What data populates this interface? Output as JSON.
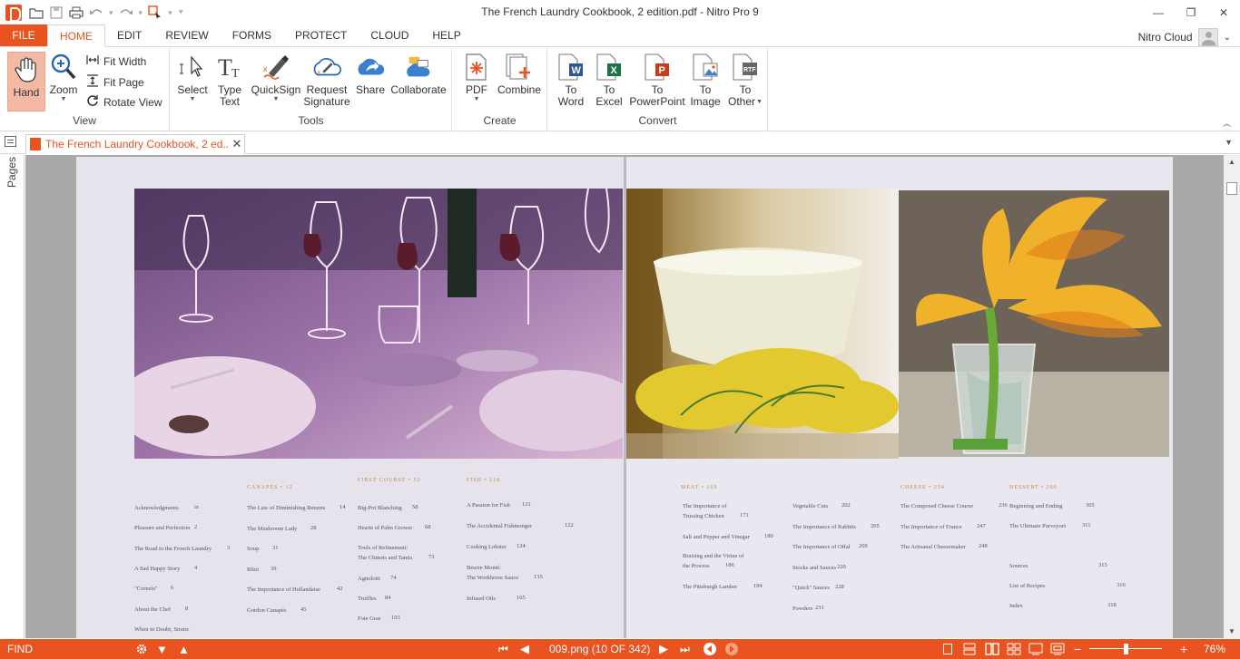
{
  "window": {
    "title": "The French Laundry Cookbook, 2 edition.pdf - Nitro Pro 9",
    "minimize_glyph": "—",
    "restore_glyph": "❐",
    "close_glyph": "✕"
  },
  "ribbon_tabs": {
    "file": "FILE",
    "tabs": [
      "HOME",
      "EDIT",
      "REVIEW",
      "FORMS",
      "PROTECT",
      "CLOUD",
      "HELP"
    ],
    "active": "HOME"
  },
  "cloud": {
    "label": "Nitro Cloud"
  },
  "ribbon": {
    "view": {
      "label": "View",
      "hand": "Hand",
      "zoom": "Zoom",
      "fit_width": "Fit Width",
      "fit_page": "Fit Page",
      "rotate_view": "Rotate View"
    },
    "tools": {
      "label": "Tools",
      "select": "Select",
      "type_text_1": "Type",
      "type_text_2": "Text",
      "quicksign": "QuickSign",
      "request_sig_1": "Request",
      "request_sig_2": "Signature",
      "share": "Share",
      "collaborate": "Collaborate"
    },
    "create": {
      "label": "Create",
      "pdf": "PDF",
      "combine": "Combine"
    },
    "convert": {
      "label": "Convert",
      "to_word_1": "To",
      "to_word_2": "Word",
      "to_excel_1": "To",
      "to_excel_2": "Excel",
      "to_ppt_1": "To",
      "to_ppt_2": "PowerPoint",
      "to_image_1": "To",
      "to_image_2": "Image",
      "to_other_1": "To",
      "to_other_2": "Other"
    }
  },
  "doc_tab": {
    "title": "The French Laundry Cookbook, 2 ed...",
    "close": "✕"
  },
  "side_panel": {
    "pages_label": "Pages"
  },
  "toc": {
    "front": [
      {
        "t": "Acknowledgments",
        "p": "ix"
      },
      {
        "t": "Pleasure and Perfection",
        "p": "2"
      },
      {
        "t": "The Road to the French Laundry",
        "p": "3"
      },
      {
        "t": "A Sad Happy Story",
        "p": "4"
      },
      {
        "t": "\"Cornets\"",
        "p": "6"
      },
      {
        "t": "About the Chef",
        "p": "8"
      },
      {
        "t": "When in Doubt, Strain:",
        "p": ""
      }
    ],
    "canapes_head": "CANAPES • 12",
    "canapes": [
      {
        "t": "The Law of Diminishing Returns",
        "p": "14"
      },
      {
        "t": "The Mushroom Lady",
        "p": "28"
      },
      {
        "t": "Soup",
        "p": "31"
      },
      {
        "t": "Blini",
        "p": "39"
      },
      {
        "t": "The Importance of Hollandaise",
        "p": "42"
      },
      {
        "t": "Gordon Canapés",
        "p": "45"
      }
    ],
    "first_head": "FIRST COURSE • 52",
    "first": [
      {
        "t": "Big-Pot Blanching",
        "p": "58"
      },
      {
        "t": "Hearts of Palm Grower",
        "p": "68"
      },
      {
        "t": "Tools of Refinement:",
        "p": ""
      },
      {
        "t": "The Chinois and Tamis",
        "p": "73"
      },
      {
        "t": "Agnolotti",
        "p": "74"
      },
      {
        "t": "Truffles",
        "p": "84"
      },
      {
        "t": "Foie Gras",
        "p": "103"
      }
    ],
    "fish_head": "FISH • 118",
    "fish": [
      {
        "t": "A Passion for Fish",
        "p": "121"
      },
      {
        "t": "The Accidental Fishmonger",
        "p": "122"
      },
      {
        "t": "Cooking Lobster",
        "p": "124"
      },
      {
        "t": "Beurre Monté:",
        "p": ""
      },
      {
        "t": "The Workhorse Sauce",
        "p": "135"
      },
      {
        "t": "Infused Oils",
        "p": "165"
      }
    ],
    "meat_head": "MEAT • 169",
    "meat": [
      {
        "t": "The Importance of",
        "p": ""
      },
      {
        "t": "Trussing Chicken",
        "p": "171"
      },
      {
        "t": "Salt and Pepper and Vinegar",
        "p": "180"
      },
      {
        "t": "Braising and the Virtue of",
        "p": ""
      },
      {
        "t": "the Process",
        "p": "186"
      },
      {
        "t": "The Pittsburgh Lamber",
        "p": "194"
      }
    ],
    "meat2": [
      {
        "t": "Vegetable Cuts",
        "p": "202"
      },
      {
        "t": "The Importance of Rabbits",
        "p": "205"
      },
      {
        "t": "The Importance of Offal",
        "p": "209"
      },
      {
        "t": "Stocks and Sauces",
        "p": "220"
      },
      {
        "t": "\"Quick\" Sauces",
        "p": "228"
      },
      {
        "t": "Powders",
        "p": "231"
      }
    ],
    "cheese_head": "CHEESE • 234",
    "cheese": [
      {
        "t": "The Composed Cheese Course",
        "p": "236"
      },
      {
        "t": "The Importance of France",
        "p": "247"
      },
      {
        "t": "The Artisanal Cheesemaker",
        "p": "248"
      }
    ],
    "dessert_head": "DESSERT • 260",
    "dessert": [
      {
        "t": "Beginning and Ending",
        "p": "305"
      },
      {
        "t": "The Ultimate Purveyors",
        "p": "311"
      },
      {
        "t": "Sources",
        "p": "315"
      },
      {
        "t": "List of Recipes",
        "p": "316"
      },
      {
        "t": "Index",
        "p": "318"
      }
    ]
  },
  "statusbar": {
    "find": "FIND",
    "page_indicator": "009.png (10 OF 342)",
    "zoom": "76%",
    "zoom_level": 0.5
  },
  "colors": {
    "accent": "#e8531f"
  }
}
